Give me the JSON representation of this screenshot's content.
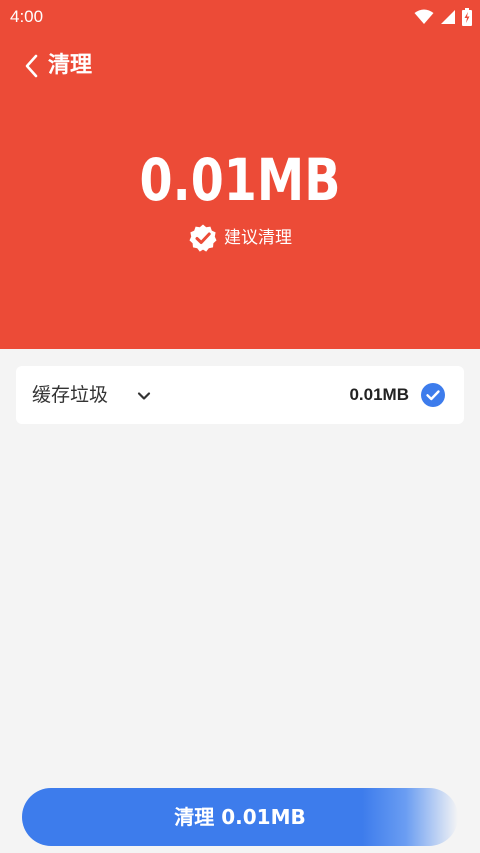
{
  "status_bar": {
    "time": "4:00",
    "icons": [
      "wifi-icon",
      "signal-icon",
      "battery-charging-icon"
    ]
  },
  "app_bar": {
    "back_icon": "chevron-left-icon",
    "title": "清理"
  },
  "summary": {
    "size": "0.01MB",
    "badge_icon": "check-badge-icon",
    "recommendation": "建议清理"
  },
  "items": [
    {
      "label": "缓存垃圾",
      "expand_icon": "chevron-down-icon",
      "size": "0.01MB",
      "checked": true
    }
  ],
  "action": {
    "clean_label": "清理 0.01MB"
  },
  "colors": {
    "header_bg": "#ec4b37",
    "page_bg": "#f4f4f4",
    "accent": "#3d7cec",
    "text_dark": "#333333"
  }
}
